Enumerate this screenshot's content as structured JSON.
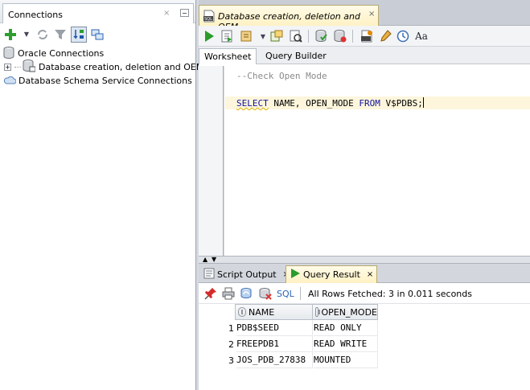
{
  "connections_panel": {
    "title": "Connections",
    "close_glyph": "×",
    "tree": [
      {
        "label": "Oracle Connections",
        "icon": "database-icon"
      },
      {
        "label": "Database creation, deletion and OEM",
        "icon": "connection-icon",
        "expander": "+"
      },
      {
        "label": "Database Schema Service Connections",
        "icon": "cloud-icon"
      }
    ]
  },
  "worksheet": {
    "doc_tab_label": "Database creation, deletion and OEM",
    "doc_tab_close": "×",
    "tabs": [
      "Worksheet",
      "Query Builder"
    ],
    "code": {
      "comment": "--Check Open Mode",
      "keyword_select": "SELECT",
      "columns": " NAME, OPEN_MODE ",
      "keyword_from": "FROM",
      "table": " V$PDBS;"
    }
  },
  "results": {
    "tabs": [
      {
        "label": "Script Output",
        "close": "×"
      },
      {
        "label": "Query Result",
        "close": "×"
      }
    ],
    "sql_link": "SQL",
    "status": "All Rows Fetched: 3 in 0.011 seconds",
    "columns": [
      "NAME",
      "OPEN_MODE"
    ],
    "rows": [
      {
        "num": "1",
        "name": "PDB$SEED",
        "open_mode": "READ ONLY"
      },
      {
        "num": "2",
        "name": "FREEPDB1",
        "open_mode": "READ WRITE"
      },
      {
        "num": "3",
        "name": "JOS_PDB_27838",
        "open_mode": "MOUNTED"
      }
    ]
  },
  "colors": {
    "active_tab": "#fff1c4",
    "keyword": "#1010a0",
    "comment": "#8a8a8a"
  }
}
